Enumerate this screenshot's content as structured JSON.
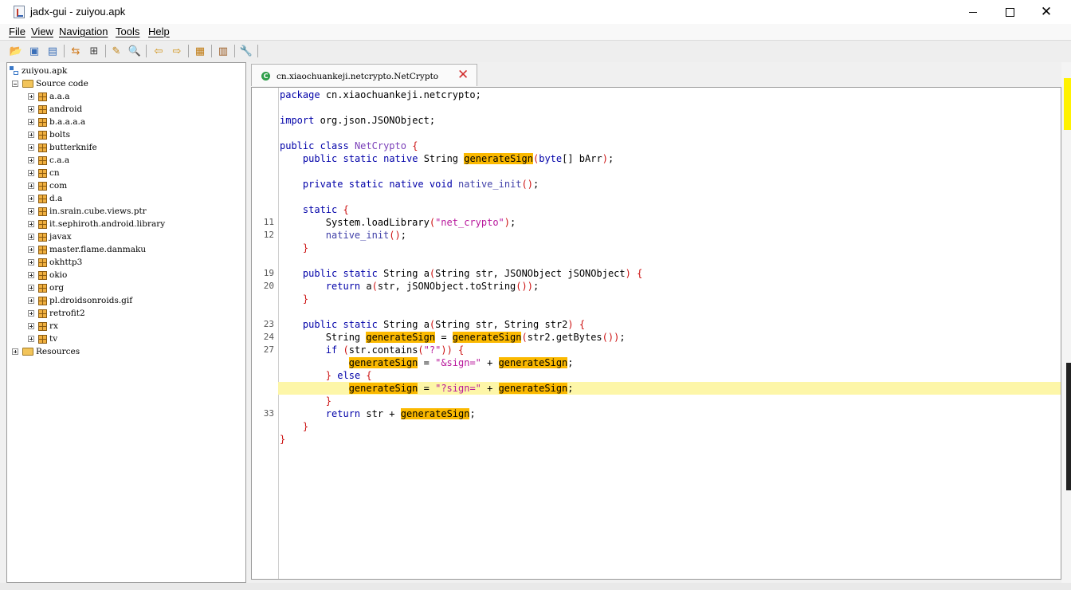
{
  "window": {
    "title": "jadx-gui - zuiyou.apk",
    "controls": {
      "minimize": "–",
      "maximize": "□",
      "close": "✕"
    }
  },
  "menu": [
    "File",
    "View",
    "Navigation",
    "Tools",
    "Help"
  ],
  "toolbar_icons": [
    {
      "name": "open-file-icon",
      "glyph": "📂",
      "color": "#d9a520"
    },
    {
      "name": "save-all-icon",
      "glyph": "▣",
      "color": "#3a6fb8"
    },
    {
      "name": "export-icon",
      "glyph": "▤",
      "color": "#3a6fb8"
    },
    {
      "name": "sync-tree-icon",
      "glyph": "⇆",
      "color": "#d07818"
    },
    {
      "name": "flatten-packages-icon",
      "glyph": "⊞",
      "color": "#444444"
    },
    {
      "name": "text-search-icon",
      "glyph": "✎",
      "color": "#c08010"
    },
    {
      "name": "class-search-icon",
      "glyph": "🔍",
      "color": "#4a7ab8"
    },
    {
      "name": "back-icon",
      "glyph": "⇦",
      "color": "#d09010"
    },
    {
      "name": "forward-icon",
      "glyph": "⇨",
      "color": "#d09010"
    },
    {
      "name": "deobfuscation-icon",
      "glyph": "▦",
      "color": "#c07a10"
    },
    {
      "name": "log-viewer-icon",
      "glyph": "▥",
      "color": "#9a5a20"
    },
    {
      "name": "preferences-icon",
      "glyph": "🔧",
      "color": "#5a6a8a"
    }
  ],
  "tree": {
    "root": "zuiyou.apk",
    "source": "Source code",
    "packages": [
      "a.a.a",
      "android",
      "b.a.a.a.a",
      "bolts",
      "butterknife",
      "c.a.a",
      "cn",
      "com",
      "d.a",
      "in.srain.cube.views.ptr",
      "it.sephiroth.android.library",
      "javax",
      "master.flame.danmaku",
      "okhttp3",
      "okio",
      "org",
      "pl.droidsonroids.gif",
      "retrofit2",
      "rx",
      "tv"
    ],
    "resources": "Resources"
  },
  "tab": {
    "label": "cn.xiaochuankeji.netcrypto.NetCrypto",
    "icon": "C"
  },
  "gutter": {
    "l11": "11",
    "l12": "12",
    "l19": "19",
    "l20": "20",
    "l23": "23",
    "l24": "24",
    "l27": "27",
    "l33": "33"
  },
  "code": {
    "package": "package",
    "pkg_name": "cn.xiaochuankeji.netcrypto;",
    "import": "import",
    "import_name": "org.json.JSONObject;",
    "public": "public",
    "class": "class",
    "class_name": "NetCrypto",
    "static": "static",
    "native": "native",
    "private": "private",
    "void": "void",
    "return": "return",
    "if": "if",
    "else": "else",
    "byte": "byte",
    "String": "String",
    "JSONObject": "JSONObject",
    "generateSign": "generateSign",
    "native_init": "native_init",
    "a": "a",
    "System_loadLibrary": "System.loadLibrary",
    "lib_name": "\"net_crypto\"",
    "q_mark": "\"?\"",
    "amp_sign": "\"&sign=\"",
    "q_sign": "\"?sign=\"",
    "bArr": " bArr",
    "str": "str",
    "str2": "str2",
    "jSONObject": "jSONObject",
    "str_contains": "str.contains",
    "jsonobj_tostring": "jSONObject.toString",
    "str2_getbytes": "str2.getBytes"
  },
  "colors": {
    "keyword": "#0000a8",
    "string": "#b8179c",
    "highlight": "#fbb900",
    "current_line": "#fdf6a8",
    "brace": "#cc1010"
  }
}
